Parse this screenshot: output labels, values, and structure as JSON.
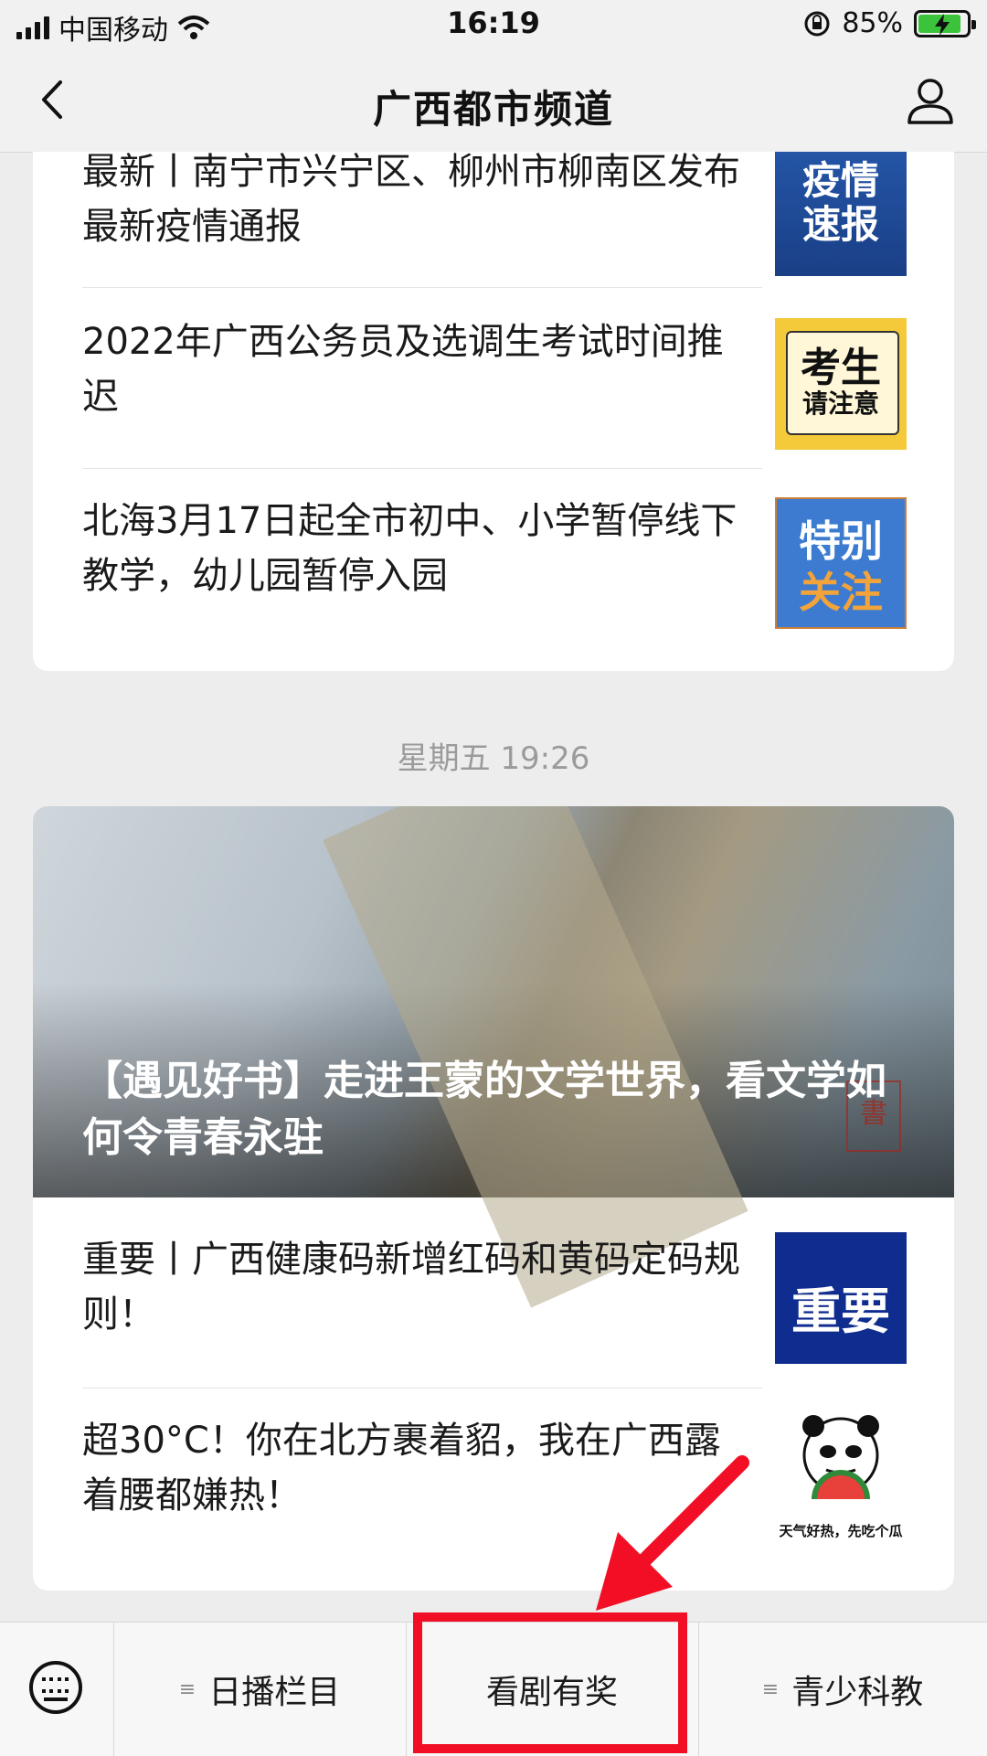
{
  "status_bar": {
    "carrier": "中国移动",
    "time": "16:19",
    "battery": "85%",
    "icons": [
      "signal-icon",
      "wifi-icon",
      "rotation-lock-icon",
      "battery-charging-icon"
    ]
  },
  "nav": {
    "title": "广西都市频道",
    "icons": [
      "back-icon",
      "user-icon"
    ]
  },
  "card1": {
    "items": [
      {
        "title": "最新丨南宁市兴宁区、柳州市柳南区发布最新疫情通报",
        "thumb_line1": "疫情",
        "thumb_line2": "速报"
      },
      {
        "title": "2022年广西公务员及选调生考试时间推迟",
        "thumb_line1": "考生",
        "thumb_line2": "请注意"
      },
      {
        "title": "北海3月17日起全市初中、小学暂停线下教学，幼儿园暂停入园",
        "thumb_line1": "特别",
        "thumb_line2": "关注"
      }
    ]
  },
  "timestamp": "星期五 19:26",
  "card2": {
    "feature": {
      "title": "【遇见好书】走进王蒙的文学世界，看文学如何令青春永驻",
      "seal": "書"
    },
    "items": [
      {
        "title": "重要丨广西健康码新增红码和黄码定码规则！",
        "thumb_line1": "重要"
      },
      {
        "title": "超30°C！你在北方裹着貂，我在广西露着腰都嫌热！",
        "thumb_caption": "天气好热，先吃个瓜"
      }
    ]
  },
  "bottom_menu": {
    "items": [
      {
        "label": "日播栏目"
      },
      {
        "label": "看剧有奖"
      },
      {
        "label": "青少科教"
      }
    ]
  },
  "colors": {
    "highlight": "#f20f26",
    "charge": "#3cc33c"
  }
}
